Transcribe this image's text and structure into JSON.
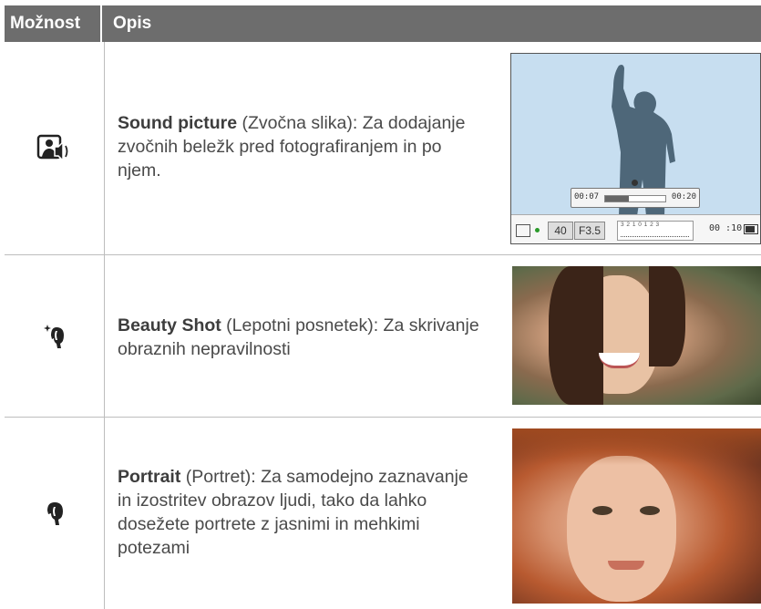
{
  "header": {
    "col_option": "Možnost",
    "col_desc": "Opis"
  },
  "rows": [
    {
      "icon": "sound-picture-icon",
      "title": "Sound picture",
      "desc": " (Zvočna slika): Za dodajanje zvočnih beležk pred fotografiranjem in po njem."
    },
    {
      "icon": "beauty-shot-icon",
      "title": "Beauty Shot",
      "desc": " (Lepotni posnetek): Za skrivanje obraznih nepravilnosti"
    },
    {
      "icon": "portrait-icon",
      "title": "Portrait",
      "desc": " (Portret): Za samodejno zaznavanje in izostritev obrazov ljudi, tako da lahko dosežete portrete z jasnimi in mehkimi potezami"
    }
  ],
  "camera_screen": {
    "time_start": "00:07",
    "time_end": "00:20",
    "iso": "40",
    "aperture": "F3.5",
    "ev_scale": "3 2 1 0 1 2 3",
    "remaining": "00 :10"
  }
}
